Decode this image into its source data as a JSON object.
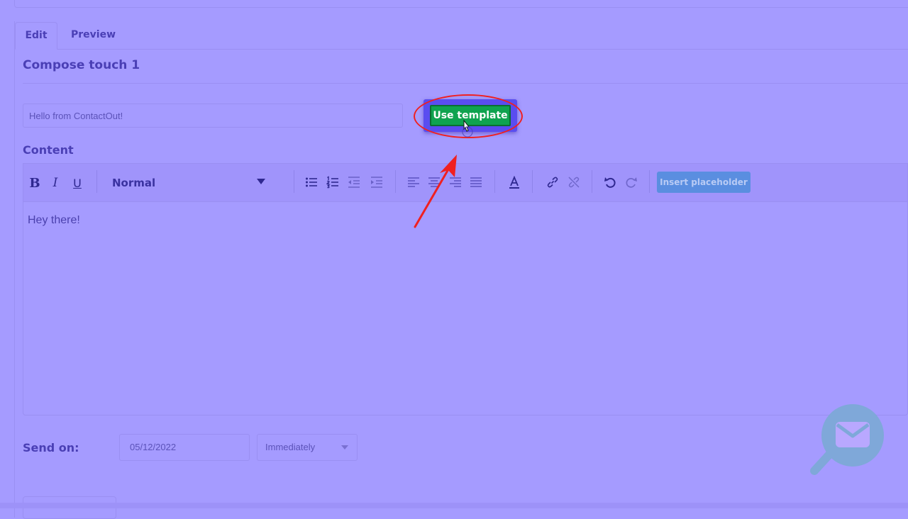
{
  "tabs": {
    "edit": "Edit",
    "preview": "Preview"
  },
  "compose": {
    "title": "Compose touch 1"
  },
  "subject": {
    "value": "Hello from ContactOut!"
  },
  "template_button": {
    "label": "Use template"
  },
  "content": {
    "label": "Content",
    "toolbar": {
      "bold": "B",
      "italic": "I",
      "underline": "U",
      "style_select": "Normal",
      "insert_placeholder": "Insert placeholder"
    },
    "body": "Hey there!"
  },
  "send": {
    "label": "Send on:",
    "date": "05/12/2022",
    "timing": "Immediately"
  },
  "colors": {
    "overlay": "#a59bff",
    "accent_green": "#0fa34f",
    "annotation_red": "#f02020",
    "insert_button": "#5a8ee0"
  },
  "icons": [
    "bullet-list-icon",
    "numbered-list-icon",
    "outdent-icon",
    "indent-icon",
    "align-left-icon",
    "align-center-icon",
    "align-right-icon",
    "align-justify-icon",
    "text-color-icon",
    "link-icon",
    "unlink-icon",
    "undo-icon",
    "redo-icon",
    "mail-search-icon"
  ]
}
